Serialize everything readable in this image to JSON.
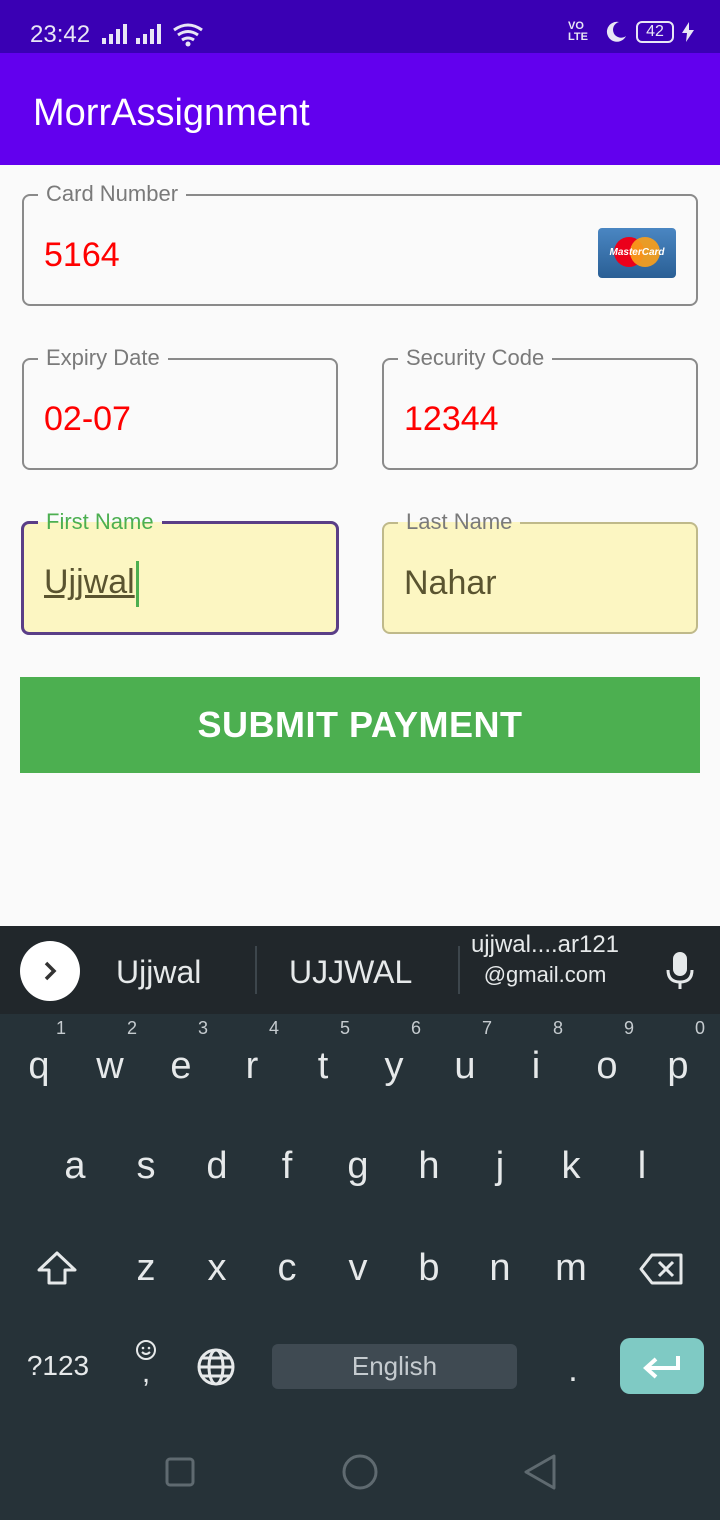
{
  "status": {
    "time": "23:42",
    "volte": "VO LTE",
    "battery": "42"
  },
  "app": {
    "title": "MorrAssignment"
  },
  "form": {
    "card_number": {
      "label": "Card Number",
      "value": "5164",
      "card_brand": "MasterCard"
    },
    "expiry": {
      "label": "Expiry Date",
      "value": "02-07"
    },
    "security": {
      "label": "Security Code",
      "value": "12344"
    },
    "first_name": {
      "label": "First Name",
      "value": "Ujjwal"
    },
    "last_name": {
      "label": "Last Name",
      "value": "Nahar"
    },
    "submit_label": "SUBMIT PAYMENT"
  },
  "keyboard": {
    "suggestions": [
      "Ujjwal",
      "UJJWAL"
    ],
    "email_suggestion": {
      "line1": "ujjwal....ar121",
      "line2": "@gmail.com"
    },
    "row1": [
      "q",
      "w",
      "e",
      "r",
      "t",
      "y",
      "u",
      "i",
      "o",
      "p"
    ],
    "row1_hints": [
      "1",
      "2",
      "3",
      "4",
      "5",
      "6",
      "7",
      "8",
      "9",
      "0"
    ],
    "row2": [
      "a",
      "s",
      "d",
      "f",
      "g",
      "h",
      "j",
      "k",
      "l"
    ],
    "row3": [
      "z",
      "x",
      "c",
      "v",
      "b",
      "n",
      "m"
    ],
    "symbols_label": "?123",
    "emoji_comma": ",",
    "space_label": "English",
    "period": "."
  },
  "colors": {
    "status_bar": "#3a00b4",
    "app_bar": "#6200ee",
    "value_red": "#ff0000",
    "submit_green": "#4caf50",
    "name_field_bg": "#fcf6c2",
    "keyboard_bg": "#263238",
    "enter_key": "#7fcac4"
  }
}
